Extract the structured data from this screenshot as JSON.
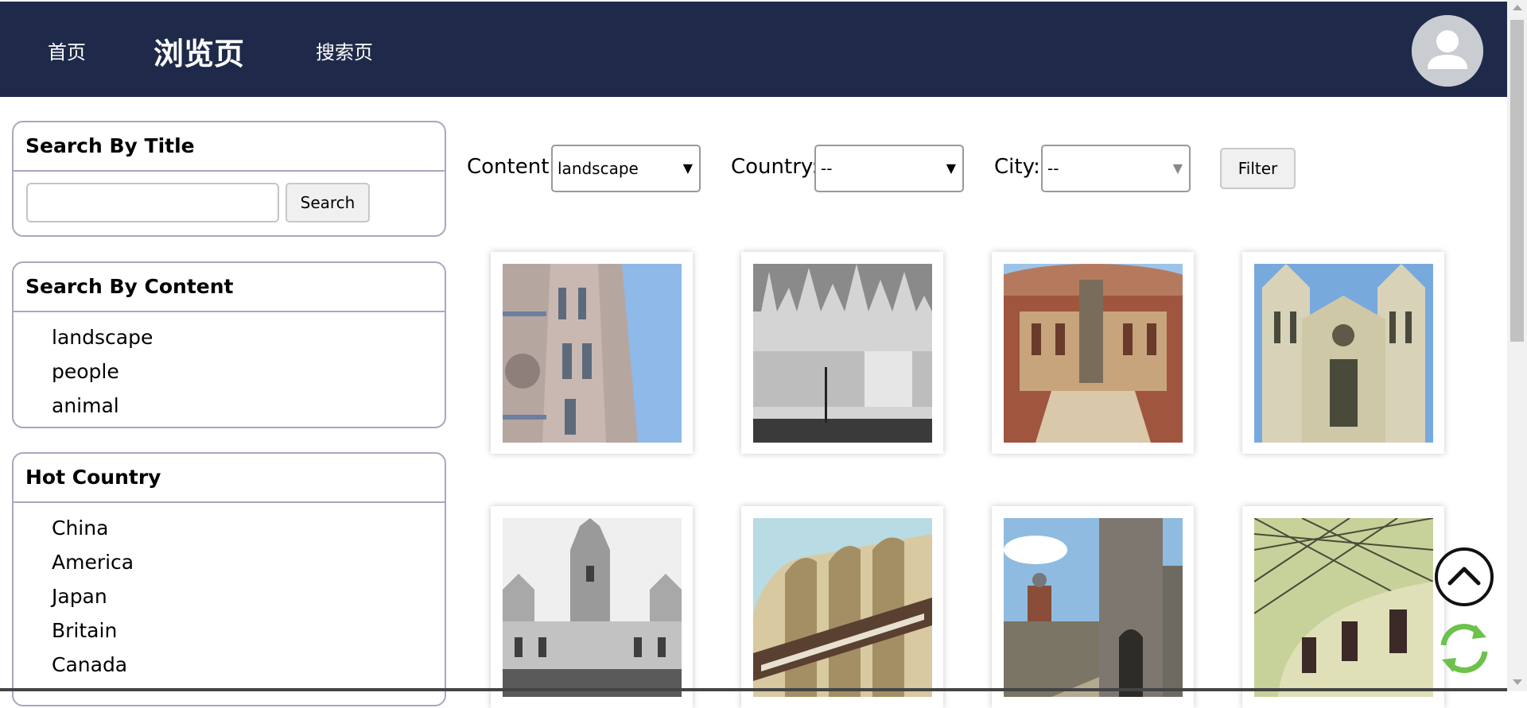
{
  "header": {
    "nav": [
      {
        "label": "首页"
      },
      {
        "label": "浏览页"
      },
      {
        "label": "搜索页"
      }
    ]
  },
  "sidebar": {
    "title_search": {
      "title": "Search By Title",
      "input_value": "",
      "button_label": "Search"
    },
    "content_search": {
      "title": "Search By Content",
      "items": [
        "landscape",
        "people",
        "animal"
      ]
    },
    "hot_country": {
      "title": "Hot Country",
      "items": [
        "China",
        "America",
        "Japan",
        "Britain",
        "Canada"
      ]
    }
  },
  "filter": {
    "content": {
      "label": "Content:",
      "selected": "landscape"
    },
    "country": {
      "label": "Country:",
      "selected": "--"
    },
    "city": {
      "label": "City:",
      "selected": "--"
    },
    "button_label": "Filter"
  },
  "gallery": {
    "images": [
      {
        "subject": "Florence cathedral bell tower"
      },
      {
        "subject": "Milan cathedral (black and white)"
      },
      {
        "subject": "Royal Albert Hall with statue"
      },
      {
        "subject": "Westminster Abbey facade"
      },
      {
        "subject": "Palace with clock towers (black and white)"
      },
      {
        "subject": "Santiago Bernabeu stadium facade"
      },
      {
        "subject": "Stone castle tower and gate"
      },
      {
        "subject": "Glass roof rotunda"
      }
    ]
  },
  "floating_buttons": {
    "back_to_top": "chevron-up-icon",
    "refresh": "refresh-icon"
  },
  "colors": {
    "header_bg": "#1f2a4a",
    "panel_border": "#a7a9bf",
    "refresh_green": "#6cc24a"
  }
}
